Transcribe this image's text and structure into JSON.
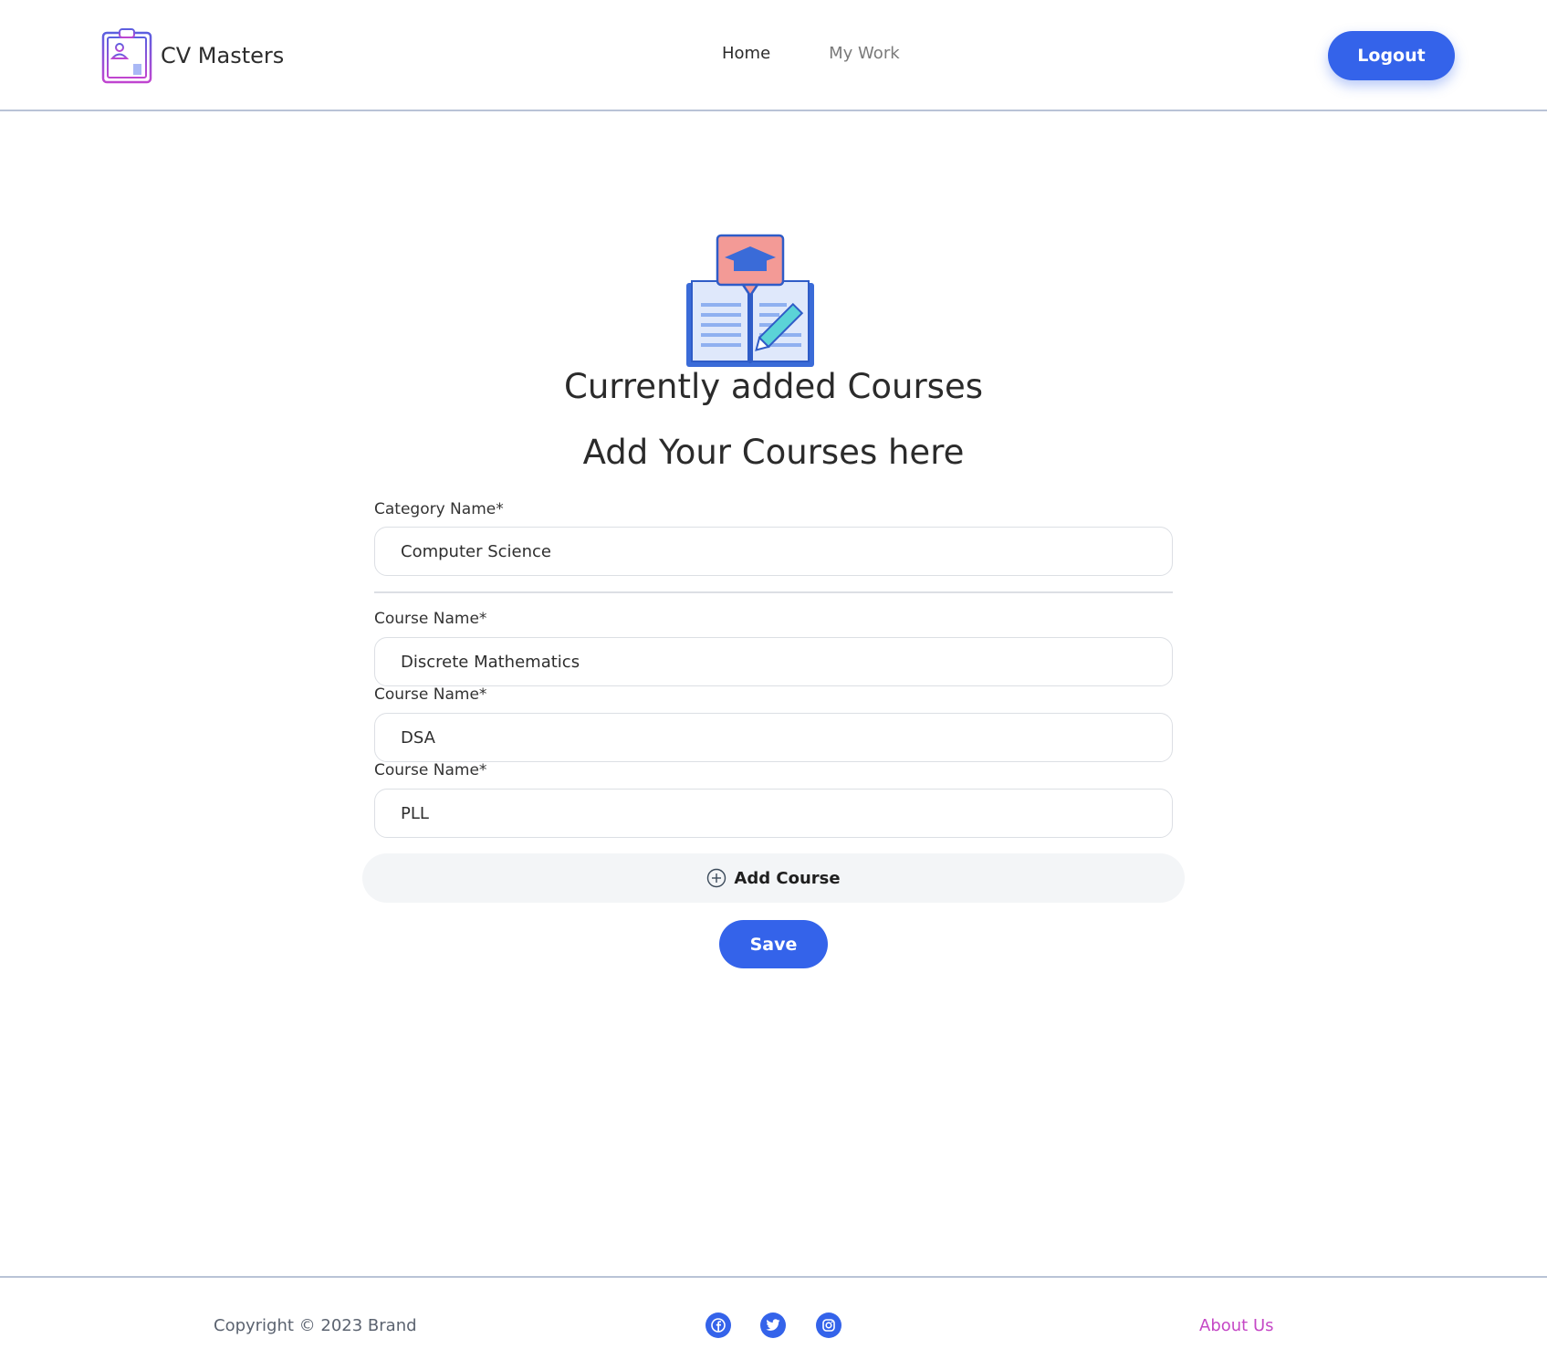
{
  "header": {
    "brand_name": "CV Masters",
    "brand_icon": "clipboard-resume-icon",
    "nav": [
      {
        "label": "Home",
        "active": true
      },
      {
        "label": "My Work",
        "active": false
      }
    ],
    "logout_label": "Logout"
  },
  "main": {
    "hero_icon": "book-graduation-icon",
    "title": "Currently added Courses",
    "subtitle": "Add Your Courses here",
    "category": {
      "label": "Category Name*",
      "value": "Computer Science"
    },
    "courses": [
      {
        "label": "Course Name*",
        "value": "Discrete Mathematics"
      },
      {
        "label": "Course Name*",
        "value": "DSA"
      },
      {
        "label": "Course Name*",
        "value": "PLL"
      }
    ],
    "add_course_label": "Add Course",
    "save_label": "Save"
  },
  "footer": {
    "copyright": "Copyright © 2023 Brand",
    "social_icons": [
      "facebook-icon",
      "twitter-icon",
      "instagram-icon"
    ],
    "about_label": "About Us"
  },
  "colors": {
    "primary": "#3463ea",
    "accent_link": "#c548c6",
    "border": "#dcdfe4",
    "add_course_bg": "#f3f5f7"
  }
}
